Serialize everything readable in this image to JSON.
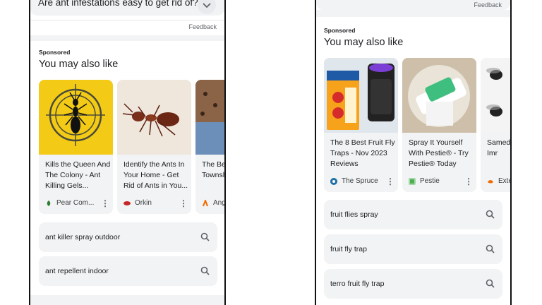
{
  "left": {
    "faq_question": "Are ant infestations easy to get rid of?",
    "feedback": "Feedback",
    "sponsored": "Sponsored",
    "section_title": "You may also like",
    "ads": [
      {
        "title": "Kills the Queen And The Colony - Ant Killing Gels...",
        "source": "Pear Com...",
        "favicon_color": "#2e7d32"
      },
      {
        "title": "Identify the Ants In Your Home - Get Rid of Ants in You...",
        "source": "Orkin",
        "favicon_color": "#c62828"
      },
      {
        "title": "The Bes Hopew Townsh",
        "source": "Ang",
        "favicon_color": "#ef6c00"
      }
    ],
    "searches": [
      "ant killer spray outdoor",
      "ant repellent indoor"
    ]
  },
  "right": {
    "feedback": "Feedback",
    "sponsored": "Sponsored",
    "section_title": "You may also like",
    "ads": [
      {
        "title": "The 8 Best Fruit Fly Traps - Nov 2023 Reviews",
        "source": "The Spruce",
        "favicon_color": "#1e6fa5"
      },
      {
        "title": "Spray It Yourself With Pestie® - Try Pestie® Today",
        "source": "Pestie",
        "favicon_color": "#4caf50"
      },
      {
        "title": "Samed Fruit Fl For Imr",
        "source": "Exte",
        "favicon_color": "#ef6c00"
      }
    ],
    "searches": [
      "fruit flies spray",
      "fruit fly trap",
      "terro fruit fly trap"
    ]
  }
}
